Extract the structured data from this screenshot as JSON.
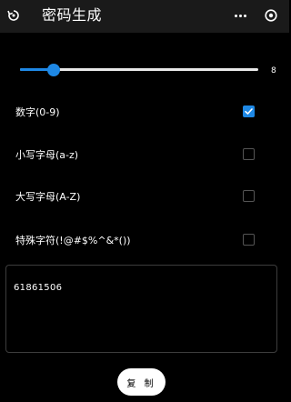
{
  "header": {
    "title": "密码生成",
    "back_icon": "back-icon",
    "more_icon": "more-dots-icon",
    "close_icon": "close-circle-icon"
  },
  "length_slider": {
    "value": 8,
    "value_label": "8",
    "fill_fraction": 0.14,
    "accent": "#1e88e5"
  },
  "options": [
    {
      "label": "数字(0-9)",
      "checked": true
    },
    {
      "label": "小写字母(a-z)",
      "checked": false
    },
    {
      "label": "大写字母(A-Z)",
      "checked": false
    },
    {
      "label": "特殊字符(!@#$%^&*())",
      "checked": false
    }
  ],
  "output": {
    "value": "61861506"
  },
  "copy_button": {
    "label": "复 制"
  }
}
